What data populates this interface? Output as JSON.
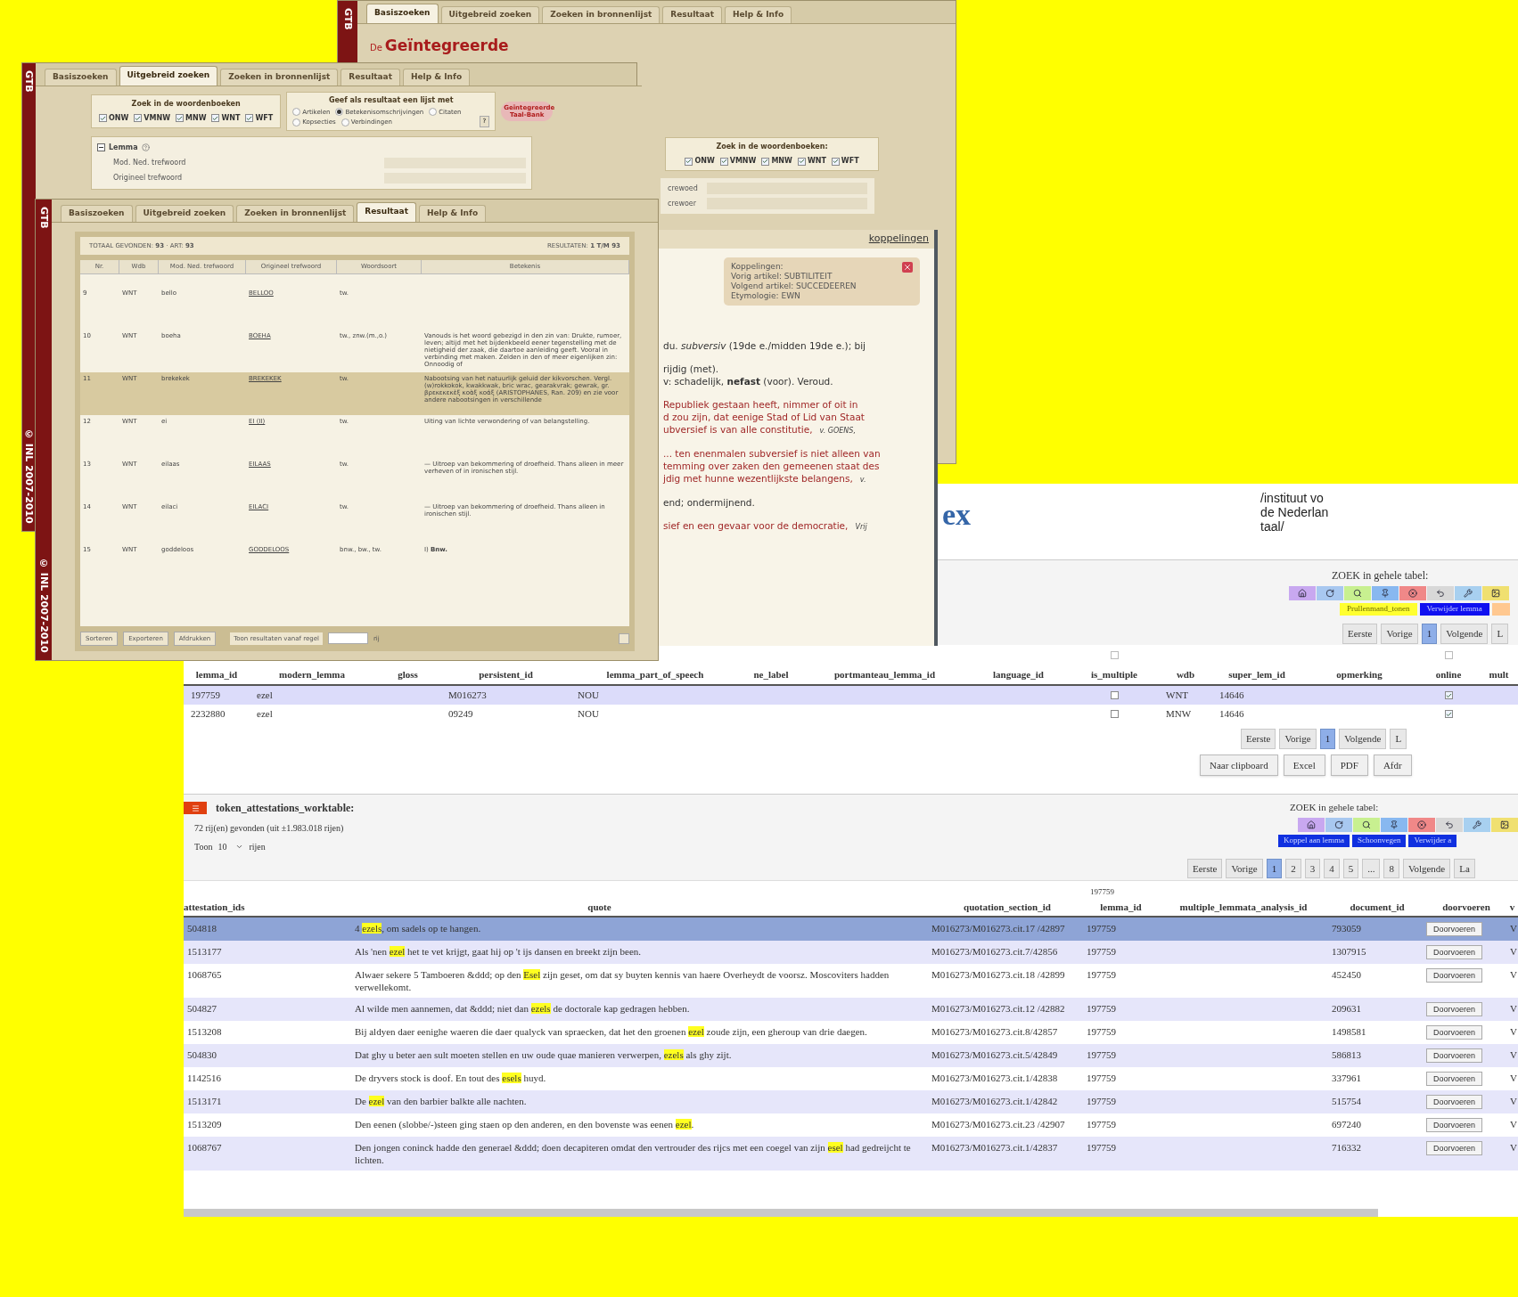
{
  "gtb_back": {
    "brand": "GTB",
    "tabs": [
      {
        "label": "Basiszoeken",
        "selected": true
      },
      {
        "label": "Uitgebreid zoeken",
        "selected": false
      },
      {
        "label": "Zoeken in bronnenlijst",
        "selected": false
      },
      {
        "label": "Resultaat",
        "selected": false
      },
      {
        "label": "Help & Info",
        "selected": false
      }
    ],
    "logo_prefix": "De",
    "logo_title": "Geïntegreerde",
    "dictionary_box": {
      "title": "Zoek in de woordenboeken:",
      "dictionaries": [
        {
          "label": "ONW",
          "checked": true
        },
        {
          "label": "VMNW",
          "checked": true
        },
        {
          "label": "MNW",
          "checked": true
        },
        {
          "label": "WNT",
          "checked": true
        },
        {
          "label": "WFT",
          "checked": true
        }
      ]
    },
    "fields": [
      {
        "label": "crewoed"
      },
      {
        "label": "crewoer"
      }
    ]
  },
  "gtb_middle": {
    "brand": "GTB",
    "copyright": "© INL 2007-2010",
    "tabs": [
      {
        "label": "Basiszoeken",
        "selected": false
      },
      {
        "label": "Uitgebreid zoeken",
        "selected": true
      },
      {
        "label": "Zoeken in bronnenlijst",
        "selected": false
      },
      {
        "label": "Resultaat",
        "selected": false
      },
      {
        "label": "Help & Info",
        "selected": false
      }
    ],
    "dictionary_box": {
      "title": "Zoek in de woordenboeken",
      "dictionaries": [
        {
          "label": "ONW",
          "checked": true
        },
        {
          "label": "VMNW",
          "checked": true
        },
        {
          "label": "MNW",
          "checked": true
        },
        {
          "label": "WNT",
          "checked": true
        },
        {
          "label": "WFT",
          "checked": true
        }
      ]
    },
    "result_box": {
      "title": "Geef als resultaat een lijst met",
      "help": "?",
      "options": [
        {
          "label": "Artikelen",
          "selected": false
        },
        {
          "label": "Betekenisomschrijvingen",
          "selected": true
        },
        {
          "label": "Citaten",
          "selected": false
        },
        {
          "label": "Kopsecties",
          "selected": false
        },
        {
          "label": "Verbindingen",
          "selected": false
        }
      ]
    },
    "logo": "Geïntegreerde Taal-Bank",
    "tree": {
      "label": "Lemma",
      "expanded": true,
      "children": [
        {
          "label": "Mod. Ned. trefwoord"
        },
        {
          "label": "Origineel trefwoord"
        }
      ]
    }
  },
  "article_panel": {
    "link": "koppelingen",
    "popup": {
      "lines": [
        "Koppelingen:",
        "Vorig artikel: SUBTILITEIT",
        "Volgend artikel: SUCCEDEEREN",
        "Etymologie: EWN"
      ]
    },
    "blocks": [
      {
        "kind": "definition",
        "lines": [
          "du. *subversiv* (19de e./midden 19de e.); bij"
        ]
      },
      {
        "kind": "definition",
        "lines": [
          "rijdig (met).",
          "v: schadelijk, **nefast** (voor). Veroud."
        ]
      },
      {
        "kind": "quote",
        "lines": [
          "Republiek gestaan heeft, nimmer of oit in",
          "d zou zijn, dat eenige Stad of Lid van Staat",
          "ubversief is van alle constitutie,"
        ],
        "source": "v. GOENS,"
      },
      {
        "kind": "quote",
        "lines": [
          "... ten enenmalen subversief is niet alleen van",
          "temming over zaken den gemeenen staat des",
          "jdig met hunne wezentlijkste belangens,"
        ],
        "source": "v."
      },
      {
        "kind": "definition",
        "lines": [
          "end; ondermijnend."
        ]
      },
      {
        "kind": "quote",
        "lines": [
          "sief en een gevaar voor de democratie,"
        ],
        "source": "Vrij"
      }
    ]
  },
  "gtb_front": {
    "brand": "GTB",
    "copyright": "© INL 2007-2010",
    "tabs": [
      {
        "label": "Basiszoeken",
        "selected": false
      },
      {
        "label": "Uitgebreid zoeken",
        "selected": false
      },
      {
        "label": "Zoeken in bronnenlijst",
        "selected": false
      },
      {
        "label": "Resultaat",
        "selected": true
      },
      {
        "label": "Help & Info",
        "selected": false
      }
    ],
    "summary": "TOTAAL GEVONDEN: **93** · ART: **93**",
    "range": "RESULTATEN: **1 T/M 93**",
    "columns": [
      "Nr.",
      "Wdb",
      "Mod. Ned. trefwoord",
      "Origineel trefwoord",
      "Woordsoort",
      "Betekenis"
    ],
    "rows": [
      {
        "nr": "9",
        "wdb": "WNT",
        "modern": "bello",
        "original": "BELLOO",
        "pos": "tw.",
        "selected": false
      },
      {
        "nr": "10",
        "wdb": "WNT",
        "modern": "boeha",
        "original": "BOEHA",
        "pos": "tw., znw.(m.,o.)",
        "meaning": "Vanouds is het woord gebezigd in den zin van: Drukte, rumoer, leven; altijd met het bijdenkbeeld eener tegenstelling met de nietigheid der zaak, die daartoe aanleiding geeft. Vooral in verbinding met maken. Zelden in den of meer eigenlijken zin: Onnoodig of",
        "selected": false
      },
      {
        "nr": "11",
        "wdb": "WNT",
        "modern": "brekekek",
        "original": "BREKEKEK",
        "pos": "tw.",
        "meaning": "Nabootsing van het natuurlijk geluid der kikvorschen. Vergl. (w)rokkokok, kwakkwak, bric wrac, gearakvrak; gewrak, gr. βρεκεκεκὲξ κοὰξ κοάξ (ARISTOPHANES, Ran. 209) en zie voor andere nabootsingen in verschillende",
        "selected": true
      },
      {
        "nr": "12",
        "wdb": "WNT",
        "modern": "ei",
        "original": "EI (II)",
        "pos": "tw.",
        "meaning": "Uiting van lichte verwondering of van belangstelling.",
        "selected": false
      },
      {
        "nr": "13",
        "wdb": "WNT",
        "modern": "eilaas",
        "original": "EILAAS",
        "pos": "tw.",
        "meaning": "— Uitroep van bekommering of droefheid. Thans alleen in meer verheven of in ironischen stijl.",
        "selected": false
      },
      {
        "nr": "14",
        "wdb": "WNT",
        "modern": "eilaci",
        "original": "EILACI",
        "pos": "tw.",
        "meaning": "— Uitroep van bekommering of droefheid. Thans alleen in ironischen stijl.",
        "selected": false
      },
      {
        "nr": "15",
        "wdb": "WNT",
        "modern": "goddeloos",
        "original": "GODDELOOS",
        "pos": "bnw., bw., tw.",
        "meaning": "I) **Bnw.**",
        "selected": false
      }
    ],
    "footer_buttons": [
      "Sorteren",
      "Exporteren",
      "Afdrukken"
    ],
    "from_row_label": "Toon resultaten vanaf regel",
    "from_row_suffix": "rij"
  },
  "database_page": {
    "logo": "ex",
    "institute_lines": [
      "/instituut vo",
      "de Nederlan",
      "taal/"
    ],
    "lemma_section": {
      "search_label": "ZOEK in gehele tabel:",
      "buttons": [
        {
          "label": "Prullenmand_tonen",
          "kind": "yellow"
        },
        {
          "label": "Verwijder lemma",
          "kind": "blue"
        },
        {
          "kind": "orange"
        }
      ],
      "pages": [
        {
          "label": "Eerste",
          "selected": false
        },
        {
          "label": "Vorige",
          "selected": false
        },
        {
          "label": "1",
          "selected": true
        },
        {
          "label": "Volgende",
          "selected": false
        },
        {
          "label": "L",
          "selected": false
        }
      ],
      "columns": [
        "lemma_id",
        "modern_lemma",
        "gloss",
        "persistent_id",
        "lemma_part_of_speech",
        "ne_label",
        "portmanteau_lemma_id",
        "language_id",
        "is_multiple",
        "wdb",
        "super_lem_id",
        "opmerking",
        "online",
        "mult"
      ],
      "rows": [
        {
          "lemma_id": "197759",
          "modern_lemma": "ezel",
          "persistent_id": "M016273",
          "lemma_part_of_speech": "NOU",
          "is_multiple": false,
          "wdb": "WNT",
          "super_lem_id": "14646",
          "online": true,
          "selected": true
        },
        {
          "lemma_id": "2232880",
          "modern_lemma": "ezel",
          "persistent_id": "09249",
          "lemma_part_of_speech": "NOU",
          "is_multiple": false,
          "wdb": "MNW",
          "super_lem_id": "14646",
          "online": true,
          "selected": false
        }
      ],
      "bottom_pages": [
        {
          "label": "Eerste",
          "selected": false
        },
        {
          "label": "Vorige",
          "selected": false
        },
        {
          "label": "1",
          "selected": true
        },
        {
          "label": "Volgende",
          "selected": false
        },
        {
          "label": "L",
          "selected": false
        }
      ],
      "export_buttons": [
        "Naar clipboard",
        "Excel",
        "PDF",
        "Afdr"
      ]
    },
    "attestation_section": {
      "title": "token_attestations_worktable:",
      "count": "72 rij(en) gevonden (uit ±1.983.018 rijen)",
      "show_label": "Toon",
      "show_value": "10",
      "show_suffix": "rijen",
      "search_label": "ZOEK in gehele tabel:",
      "buttons": [
        "Koppel aan lemma",
        "Schoonvegen",
        "Verwijder a"
      ],
      "pages": [
        {
          "label": "Eerste",
          "selected": false
        },
        {
          "label": "Vorige",
          "selected": false
        },
        {
          "label": "1",
          "selected": true
        },
        {
          "label": "2",
          "selected": false
        },
        {
          "label": "3",
          "selected": false
        },
        {
          "label": "4",
          "selected": false
        },
        {
          "label": "5",
          "selected": false
        },
        {
          "label": "...",
          "selected": false
        },
        {
          "label": "8",
          "selected": false
        },
        {
          "label": "Volgende",
          "selected": false
        },
        {
          "label": "La",
          "selected": false
        }
      ],
      "lemma_filter": "197759",
      "columns": [
        "attestation_ids",
        "quote",
        "quotation_section_id",
        "lemma_id",
        "multiple_lemmata_analysis_id",
        "document_id",
        "doorvoeren",
        "v"
      ],
      "rows": [
        {
          "attestation_ids": "504818",
          "quote": {
            "before": "4 ",
            "match": "ezels",
            "after": ", om sadels op te hangen."
          },
          "quotation_section_id": "M016273/M016273.cit.17 /42897",
          "lemma_id": "197759",
          "document_id": "793059",
          "doorvoeren": "Doorvoeren",
          "column_8": "V",
          "selected": true
        },
        {
          "attestation_ids": "1513177",
          "quote": {
            "before": "Als 'nen ",
            "match": "ezel",
            "after": " het te vet krijgt, gaat hij op 't ijs dansen en breekt zijn been."
          },
          "quotation_section_id": "M016273/M016273.cit.7/42856",
          "lemma_id": "197759",
          "document_id": "1307915",
          "doorvoeren": "Doorvoeren",
          "column_8": "V",
          "selected": false
        },
        {
          "attestation_ids": "1068765",
          "quote": {
            "before": "Alwaer sekere 5 Tamboeren &ddd; op den ",
            "match": "Esel",
            "after": " zijn geset, om dat sy buyten kennis van haere Overheydt de voorsz. Moscoviters hadden verwellekomt."
          },
          "quotation_section_id": "M016273/M016273.cit.18 /42899",
          "lemma_id": "197759",
          "document_id": "452450",
          "doorvoeren": "Doorvoeren",
          "column_8": "V",
          "selected": false
        },
        {
          "attestation_ids": "504827",
          "quote": {
            "before": "Al wilde men aannemen, dat &ddd; niet dan ",
            "match": "ezels",
            "after": " de doctorale kap gedragen hebben."
          },
          "quotation_section_id": "M016273/M016273.cit.12 /42882",
          "lemma_id": "197759",
          "document_id": "209631",
          "doorvoeren": "Doorvoeren",
          "column_8": "V",
          "selected": false
        },
        {
          "attestation_ids": "1513208",
          "quote": {
            "before": "Bij aldyen daer eenighe waeren die daer qualyck van spraecken, dat het den groenen ",
            "match": "ezel",
            "after": " zoude zijn, een gheroup van drie daegen."
          },
          "quotation_section_id": "M016273/M016273.cit.8/42857",
          "lemma_id": "197759",
          "document_id": "1498581",
          "doorvoeren": "Doorvoeren",
          "column_8": "V",
          "selected": false
        },
        {
          "attestation_ids": "504830",
          "quote": {
            "before": "Dat ghy u beter aen sult moeten stellen en uw oude quae manieren verwerpen, ",
            "match": "ezels",
            "after": " als ghy zijt."
          },
          "quotation_section_id": "M016273/M016273.cit.5/42849",
          "lemma_id": "197759",
          "document_id": "586813",
          "doorvoeren": "Doorvoeren",
          "column_8": "V",
          "selected": false
        },
        {
          "attestation_ids": "1142516",
          "quote": {
            "before": "De dryvers stock is doof. En tout des ",
            "match": "esels",
            "after": " huyd."
          },
          "quotation_section_id": "M016273/M016273.cit.1/42838",
          "lemma_id": "197759",
          "document_id": "337961",
          "doorvoeren": "Doorvoeren",
          "column_8": "V",
          "selected": false
        },
        {
          "attestation_ids": "1513171",
          "quote": {
            "before": "De ",
            "match": "ezel",
            "after": " van den barbier balkte alle nachten."
          },
          "quotation_section_id": "M016273/M016273.cit.1/42842",
          "lemma_id": "197759",
          "document_id": "515754",
          "doorvoeren": "Doorvoeren",
          "column_8": "V",
          "selected": false
        },
        {
          "attestation_ids": "1513209",
          "quote": {
            "before": "Den eenen (slobbe/-)steen ging staen op den anderen, en den bovenste was eenen ",
            "match": "ezel",
            "after": "."
          },
          "quotation_section_id": "M016273/M016273.cit.23 /42907",
          "lemma_id": "197759",
          "document_id": "697240",
          "doorvoeren": "Doorvoeren",
          "column_8": "V",
          "selected": false
        },
        {
          "attestation_ids": "1068767",
          "quote": {
            "before": "Den jongen coninck hadde den generael &ddd; doen decapiteren omdat den vertrouder des rijcs met een coegel van zijn ",
            "match": "esel",
            "after": " had gedreijcht te lichten."
          },
          "quotation_section_id": "M016273/M016273.cit.1/42837",
          "lemma_id": "197759",
          "document_id": "716332",
          "doorvoeren": "Doorvoeren",
          "column_8": "V",
          "selected": false
        }
      ]
    }
  }
}
